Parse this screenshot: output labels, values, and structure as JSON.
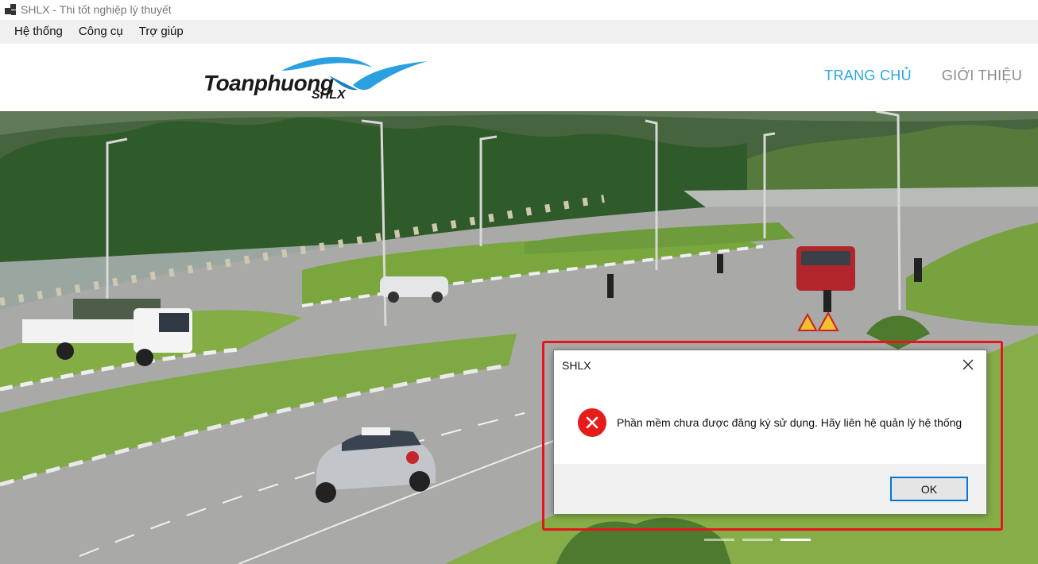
{
  "window": {
    "title": "SHLX - Thi tốt nghiệp lý thuyết",
    "icon": "app-window-icon"
  },
  "menu": {
    "items": [
      {
        "label": "Hệ thống"
      },
      {
        "label": "Công cụ"
      },
      {
        "label": "Trợ giúp"
      }
    ]
  },
  "header": {
    "logo_brand": "Toanphuong",
    "logo_sub": "SHLX",
    "nav": [
      {
        "label": "TRANG CHỦ",
        "active": true
      },
      {
        "label": "GIỚI THIỆU",
        "active": false
      }
    ]
  },
  "slider": {
    "count": 3,
    "active_index": 2
  },
  "dialog": {
    "title": "SHLX",
    "message": "Phần mềm chưa được đăng ký sử dụng. Hãy liên hệ quản lý hệ thống",
    "ok_label": "OK",
    "icon": "error-icon",
    "close_icon": "close-icon"
  },
  "colors": {
    "nav_active": "#29a8e0",
    "nav_inactive": "#8a8a8a",
    "highlight": "#e8141b",
    "error": "#e81b1b",
    "logo_wave": "#2aa0e0"
  }
}
